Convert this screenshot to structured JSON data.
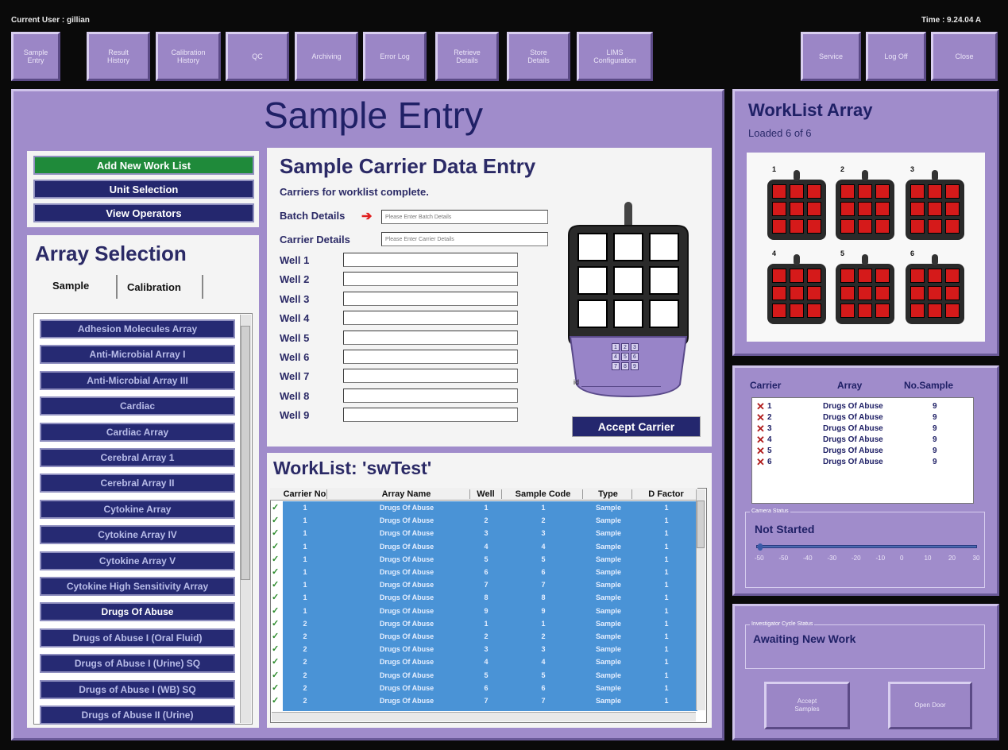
{
  "topbar": {
    "current_user": "Current User : gillian",
    "time": "Time : 9.24.04 A"
  },
  "nav_buttons": [
    {
      "label": "Sample\nEntry"
    },
    {
      "label": "Result\nHistory"
    },
    {
      "label": "Calibration\nHistory"
    },
    {
      "label": "QC"
    },
    {
      "label": "Archiving"
    },
    {
      "label": "Error Log"
    },
    {
      "label": "Retrieve\nDetails"
    },
    {
      "label": "Store\nDetails"
    },
    {
      "label": "LIMS\nConfiguration"
    }
  ],
  "right_buttons": [
    {
      "label": "Service"
    },
    {
      "label": "Log Off"
    },
    {
      "label": "Close"
    }
  ],
  "main": {
    "title": "Sample Entry",
    "side_buttons": {
      "add": "Add New Work List",
      "unit": "Unit Selection",
      "operators": "View Operators"
    },
    "array_selection": {
      "title": "Array Selection",
      "tabs": [
        "Sample",
        "Calibration"
      ],
      "items": [
        "Adhesion Molecules Array",
        "Anti-Microbial Array I",
        "Anti-Microbial Array III",
        "Cardiac",
        "Cardiac Array",
        "Cerebral Array 1",
        "Cerebral Array II",
        "Cytokine Array",
        "Cytokine Array IV",
        "Cytokine Array V",
        "Cytokine High Sensitivity Array",
        "Drugs Of Abuse",
        "Drugs of Abuse I (Oral Fluid)",
        "Drugs of Abuse I (Urine) SQ",
        "Drugs of Abuse I (WB) SQ",
        "Drugs of Abuse II (Urine)"
      ],
      "selected": "Drugs Of Abuse"
    },
    "carrier_entry": {
      "title": "Sample Carrier Data Entry",
      "status": "Carriers for worklist complete.",
      "batch_label": "Batch Details",
      "batch_placeholder": "Please Enter Batch Details",
      "carrier_label": "Carrier Details",
      "carrier_placeholder": "Please Enter Carrier Details",
      "wells": [
        "Well 1",
        "Well 2",
        "Well 3",
        "Well 4",
        "Well 5",
        "Well 6",
        "Well 7",
        "Well 8",
        "Well 9"
      ],
      "keypad": [
        "1",
        "2",
        "3",
        "4",
        "5",
        "6",
        "7",
        "8",
        "9"
      ],
      "id_label": "id",
      "accept": "Accept Carrier"
    },
    "worklist": {
      "title": "WorkList: 'swTest'",
      "columns": [
        "Carrier No",
        "Array Name",
        "Well",
        "Sample Code",
        "Type",
        "D Factor"
      ],
      "rows": [
        [
          "1",
          "Drugs Of Abuse",
          "1",
          "1",
          "Sample",
          "1"
        ],
        [
          "1",
          "Drugs Of Abuse",
          "2",
          "2",
          "Sample",
          "1"
        ],
        [
          "1",
          "Drugs Of Abuse",
          "3",
          "3",
          "Sample",
          "1"
        ],
        [
          "1",
          "Drugs Of Abuse",
          "4",
          "4",
          "Sample",
          "1"
        ],
        [
          "1",
          "Drugs Of Abuse",
          "5",
          "5",
          "Sample",
          "1"
        ],
        [
          "1",
          "Drugs Of Abuse",
          "6",
          "6",
          "Sample",
          "1"
        ],
        [
          "1",
          "Drugs Of Abuse",
          "7",
          "7",
          "Sample",
          "1"
        ],
        [
          "1",
          "Drugs Of Abuse",
          "8",
          "8",
          "Sample",
          "1"
        ],
        [
          "1",
          "Drugs Of Abuse",
          "9",
          "9",
          "Sample",
          "1"
        ],
        [
          "2",
          "Drugs Of Abuse",
          "1",
          "1",
          "Sample",
          "1"
        ],
        [
          "2",
          "Drugs Of Abuse",
          "2",
          "2",
          "Sample",
          "1"
        ],
        [
          "2",
          "Drugs Of Abuse",
          "3",
          "3",
          "Sample",
          "1"
        ],
        [
          "2",
          "Drugs Of Abuse",
          "4",
          "4",
          "Sample",
          "1"
        ],
        [
          "2",
          "Drugs Of Abuse",
          "5",
          "5",
          "Sample",
          "1"
        ],
        [
          "2",
          "Drugs Of Abuse",
          "6",
          "6",
          "Sample",
          "1"
        ],
        [
          "2",
          "Drugs Of Abuse",
          "7",
          "7",
          "Sample",
          "1"
        ]
      ]
    }
  },
  "worklist_array": {
    "title": "WorkList Array",
    "loaded": "Loaded 6 of 6",
    "carrier_numbers": [
      "1",
      "2",
      "3",
      "4",
      "5",
      "6"
    ]
  },
  "carrier_table": {
    "headers": [
      "Carrier",
      "Array",
      "No.Sample"
    ],
    "rows": [
      [
        "1",
        "Drugs Of Abuse",
        "9"
      ],
      [
        "2",
        "Drugs Of Abuse",
        "9"
      ],
      [
        "3",
        "Drugs Of Abuse",
        "9"
      ],
      [
        "4",
        "Drugs Of Abuse",
        "9"
      ],
      [
        "5",
        "Drugs Of Abuse",
        "9"
      ],
      [
        "6",
        "Drugs Of Abuse",
        "9"
      ]
    ]
  },
  "camera": {
    "group_label": "Camera Status",
    "status": "Not Started",
    "ticks": [
      "-50",
      "-50",
      "-40",
      "-30",
      "-20",
      "-10",
      "0",
      "10",
      "20",
      "30"
    ]
  },
  "cycle": {
    "group_label": "Investigator Cycle Status",
    "status": "Awaiting New Work",
    "accept_label": "Accept\nSamples",
    "open_door": "Open Door"
  }
}
